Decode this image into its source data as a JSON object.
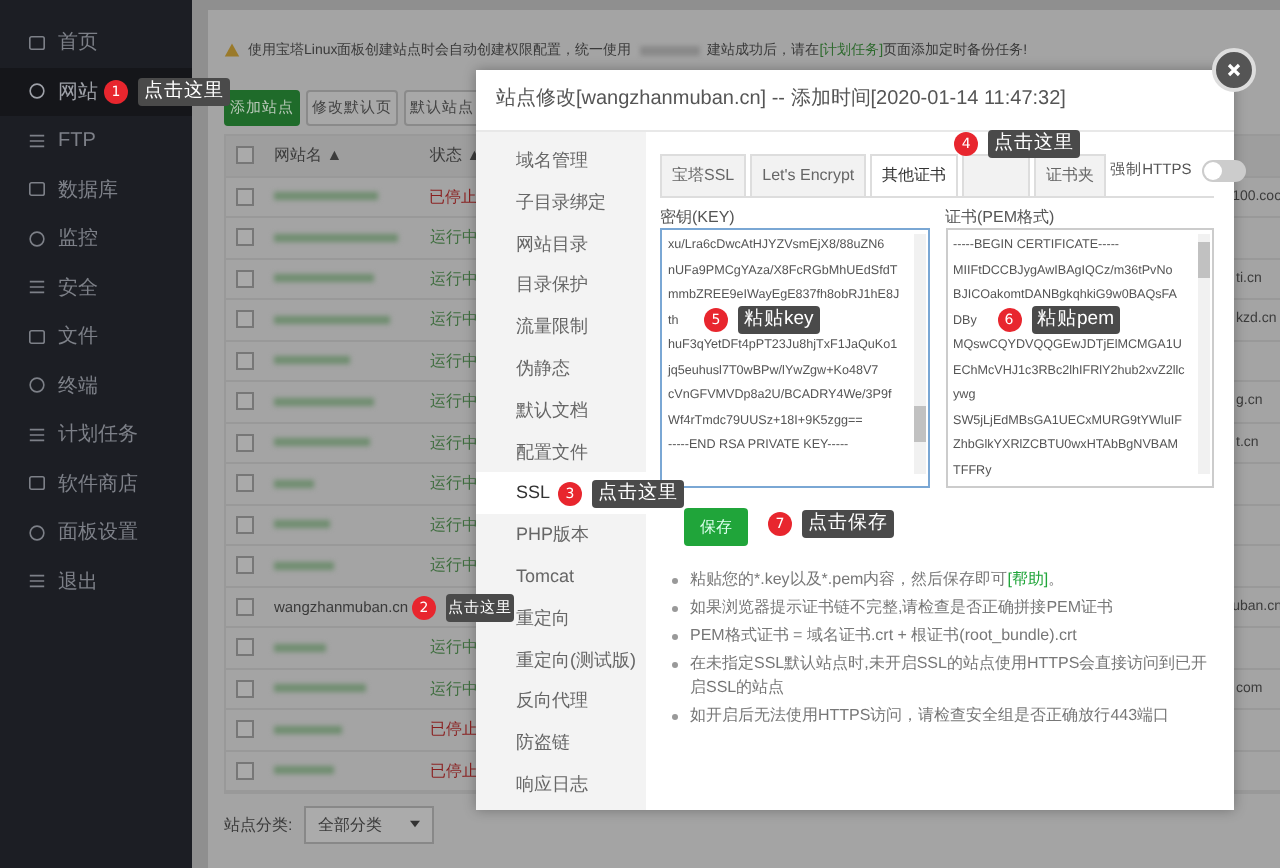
{
  "sidebar": {
    "items": [
      {
        "label": "首页",
        "selected": false
      },
      {
        "label": "网站",
        "selected": true,
        "annotation": {
          "number": "1",
          "text": "点击这里"
        }
      },
      {
        "label": "FTP",
        "selected": false
      },
      {
        "label": "数据库",
        "selected": false
      },
      {
        "label": "监控",
        "selected": false
      },
      {
        "label": "安全",
        "selected": false
      },
      {
        "label": "文件",
        "selected": false
      },
      {
        "label": "终端",
        "selected": false
      },
      {
        "label": "计划任务",
        "selected": false
      },
      {
        "label": "软件商店",
        "selected": false
      },
      {
        "label": "面板设置",
        "selected": false
      },
      {
        "label": "退出",
        "selected": false
      }
    ]
  },
  "notice": {
    "before": "使用宝塔Linux面板创建站点时会自动创建权限配置，统一使用",
    "after": "建站成功后，请在",
    "link": "[计划任务]",
    "end": "页面添加定时备份任务!"
  },
  "toolbar": [
    {
      "label": "添加站点",
      "kind": "primary"
    },
    {
      "label": "修改默认页",
      "kind": "plain"
    },
    {
      "label": "默认站点",
      "kind": "plain"
    }
  ],
  "table": {
    "select_all": {
      "checked": false
    },
    "columns": [
      "网站名 ▲",
      "状态 ▲"
    ],
    "rows": [
      {
        "checked": false,
        "status": "已停止",
        "kind": "stopped",
        "column_3": "100.coo"
      },
      {
        "checked": false,
        "status": "运行中",
        "kind": "running"
      },
      {
        "checked": false,
        "status": "运行中",
        "kind": "running",
        "column_3": "ti.cn"
      },
      {
        "checked": false,
        "status": "运行中",
        "kind": "running",
        "column_3": "kzd.cn"
      },
      {
        "checked": false,
        "status": "运行中",
        "kind": "running"
      },
      {
        "checked": false,
        "status": "运行中",
        "kind": "running",
        "column_3": "g.cn"
      },
      {
        "checked": false,
        "status": "运行中",
        "kind": "running",
        "column_3": "t.cn"
      },
      {
        "checked": false,
        "status": "运行中",
        "kind": "running"
      },
      {
        "checked": false,
        "status": "运行中",
        "kind": "running"
      },
      {
        "checked": false,
        "status": "运行中",
        "kind": "running"
      },
      {
        "checked": false,
        "name": "wangzhanmuban.cn",
        "annotation": {
          "number": "2",
          "text": "点击这里"
        },
        "column_3": "uban.cn"
      },
      {
        "checked": false,
        "status": "运行中",
        "kind": "running"
      },
      {
        "checked": false,
        "status": "运行中",
        "kind": "running",
        "column_3": "com"
      },
      {
        "checked": false,
        "status": "已停止",
        "kind": "stopped"
      },
      {
        "checked": false,
        "status": "已停止",
        "kind": "stopped"
      }
    ]
  },
  "category_filter": {
    "label": "站点分类:",
    "value": "全部分类"
  },
  "dialog": {
    "title": "站点修改[wangzhanmuban.cn] -- 添加时间[2020-01-14 11:47:32]",
    "nav": [
      {
        "label": "域名管理",
        "selected": false
      },
      {
        "label": "子目录绑定",
        "selected": false
      },
      {
        "label": "网站目录",
        "selected": false
      },
      {
        "label": "目录保护",
        "selected": false
      },
      {
        "label": "流量限制",
        "selected": false
      },
      {
        "label": "伪静态",
        "selected": false
      },
      {
        "label": "默认文档",
        "selected": false
      },
      {
        "label": "配置文件",
        "selected": false
      },
      {
        "label": "SSL",
        "selected": true,
        "annotation": {
          "number": "3",
          "text": "点击这里"
        }
      },
      {
        "label": "PHP版本",
        "selected": false
      },
      {
        "label": "Tomcat",
        "selected": false
      },
      {
        "label": "重定向",
        "selected": false
      },
      {
        "label": "重定向(测试版)",
        "selected": false
      },
      {
        "label": "反向代理",
        "selected": false
      },
      {
        "label": "防盗链",
        "selected": false
      },
      {
        "label": "响应日志",
        "selected": false
      }
    ],
    "tabs": [
      {
        "label": "宝塔SSL",
        "selected": false
      },
      {
        "label": "Let's Encrypt",
        "selected": false
      },
      {
        "label": "其他证书",
        "selected": true,
        "annotation": {
          "number": "4",
          "text": "点击这里"
        }
      },
      {
        "selected": false
      },
      {
        "label": "证书夹",
        "selected": false
      }
    ],
    "force_https": {
      "label": "强制HTTPS",
      "on": false
    },
    "key": {
      "label": "密钥(KEY)",
      "annotation": {
        "number": "5",
        "text": "粘贴key"
      },
      "lines": [
        "xu/Lra6cDwcAtHJYZVsmEjX8/88uZN6",
        "nUFa9PMCgYAza/X8FcRGbMhUEdSfdT",
        "mmbZREE9eIWayEgE837fh8obRJ1hE8J",
        "th",
        "huF3qYetDFt4pPT23Ju8hjTxF1JaQuKo1",
        "jq5euhusl7T0wBPw/lYwZgw+Ko48V7",
        "cVnGFVMVDp8a2U/BCADRY4We/3P9f",
        "Wf4rTmdc79UUSz+18I+9K5zgg==",
        "-----END RSA PRIVATE KEY-----"
      ]
    },
    "pem": {
      "label": "证书(PEM格式)",
      "annotation": {
        "number": "6",
        "text": "粘贴pem"
      },
      "lines": [
        "-----BEGIN CERTIFICATE-----",
        "MIIFtDCCBJygAwIBAgIQCz/m36tPvNo",
        "BJICOakomtDANBgkqhkiG9w0BAQsFA",
        "DBy",
        "MQswCQYDVQQGEwJDTjElMCMGA1U",
        "EChMcVHJ1c3RBc2lhIFRlY2hub2xvZ2llc",
        "ywg",
        "SW5jLjEdMBsGA1UECxMURG9tYWluIF",
        "ZhbGlkYXRlZCBTU0wxHTAbBgNVBAM",
        "TFFRy"
      ]
    },
    "save": {
      "label": "保存",
      "annotation": {
        "number": "7",
        "text": "点击保存"
      }
    },
    "tips": [
      {
        "text": "粘贴您的*.key以及*.pem内容，然后保存即可",
        "link": "[帮助]",
        "end": "。"
      },
      {
        "text": "如果浏览器提示证书链不完整,请检查是否正确拼接PEM证书"
      },
      {
        "text": "PEM格式证书 = 域名证书.crt + 根证书(root_bundle).crt"
      },
      {
        "text": "在未指定SSL默认站点时,未开启SSL的站点使用HTTPS会直接访问到已开启SSL的站点"
      },
      {
        "text": "如开启后无法使用HTTPS访问，请检查安全组是否正确放行443端口"
      }
    ]
  }
}
